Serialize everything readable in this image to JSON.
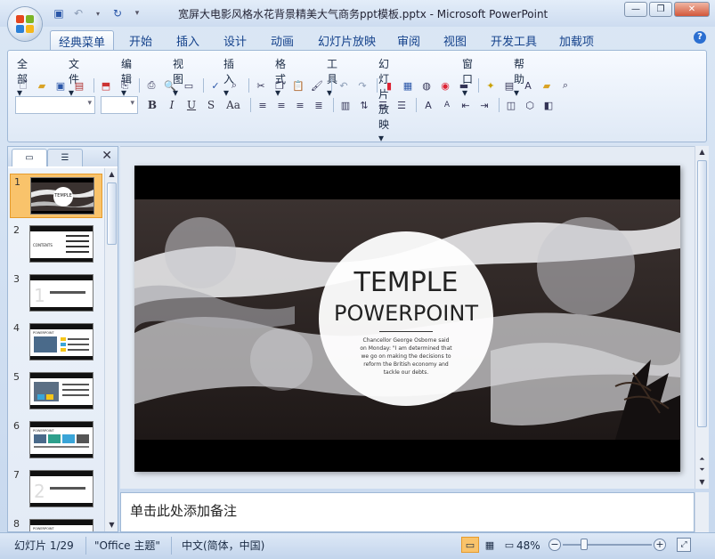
{
  "window": {
    "title": "宽屏大电影风格水花背景精美大气商务ppt模板.pptx - Microsoft PowerPoint",
    "qat": [
      "💾",
      "↶",
      "▾",
      "↷",
      "▾"
    ]
  },
  "tabs": [
    "经典菜单",
    "开始",
    "插入",
    "设计",
    "动画",
    "幻灯片放映",
    "审阅",
    "视图",
    "开发工具",
    "加载项"
  ],
  "help_label": "?",
  "menus": [
    "全部 ▾",
    "文件 ▾",
    "编辑 ▾",
    "视图 ▾",
    "插入 ▾",
    "格式 ▾",
    "工具 ▾",
    "幻灯片放映 ▾",
    "窗口 ▾",
    "帮助 ▾"
  ],
  "format_buttons": [
    "B",
    "I",
    "U",
    "S",
    "Aa"
  ],
  "left_panel": {
    "close": "✕",
    "thumbnails": [
      {
        "num": "1",
        "selected": true
      },
      {
        "num": "2",
        "selected": false
      },
      {
        "num": "3",
        "selected": false
      },
      {
        "num": "4",
        "selected": false
      },
      {
        "num": "5",
        "selected": false
      },
      {
        "num": "6",
        "selected": false
      },
      {
        "num": "7",
        "selected": false
      },
      {
        "num": "8",
        "selected": false
      }
    ],
    "thumb_labels": {
      "t1": "TEMPLE",
      "t2": "CONTENTS",
      "t3": "1",
      "t4": "POWERPOINT",
      "t7": "2",
      "t8": "POWERPOINT"
    }
  },
  "slide": {
    "title1": "TEMPLE",
    "title2": "POWERPOINT",
    "body": "Chancellor George Osborne said on Monday: \"I am determined that we go on making the decisions to reform the British economy and tackle our debts."
  },
  "notes": {
    "placeholder": "单击此处添加备注"
  },
  "status": {
    "slide": "幻灯片 1/29",
    "theme": "\"Office 主题\"",
    "lang": "中文(简体，中国)",
    "zoom": "48%",
    "zoom_minus": "−",
    "zoom_plus": "+"
  }
}
